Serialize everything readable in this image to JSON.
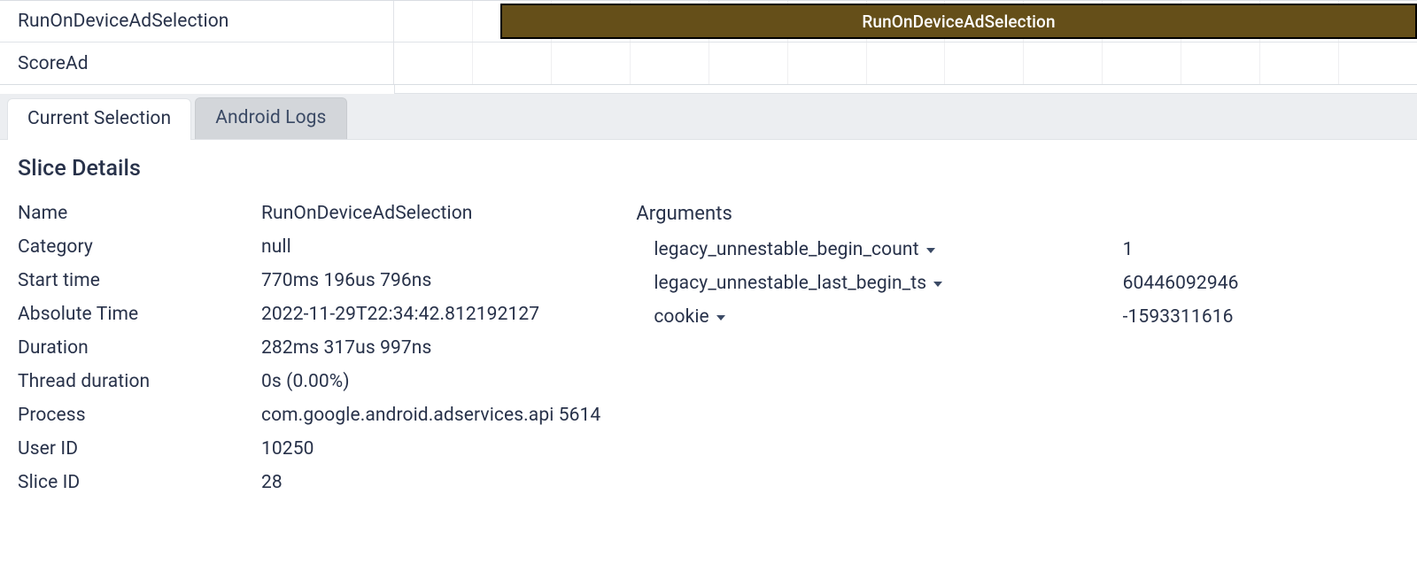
{
  "tracks": {
    "row1_label": "RunOnDeviceAdSelection",
    "row1_slice_title": "RunOnDeviceAdSelection",
    "row2_label": "ScoreAd"
  },
  "tabs": {
    "current": "Current Selection",
    "logs": "Android Logs"
  },
  "details": {
    "heading": "Slice Details",
    "labels": {
      "name": "Name",
      "category": "Category",
      "start_time": "Start time",
      "absolute_time": "Absolute Time",
      "duration": "Duration",
      "thread_duration": "Thread duration",
      "process": "Process",
      "user_id": "User ID",
      "slice_id": "Slice ID"
    },
    "values": {
      "name": "RunOnDeviceAdSelection",
      "category": "null",
      "start_time": "770ms 196us 796ns",
      "absolute_time": "2022-11-29T22:34:42.812192127",
      "duration": "282ms 317us 997ns",
      "thread_duration": "0s (0.00%)",
      "process": "com.google.android.adservices.api 5614",
      "user_id": "10250",
      "slice_id": "28"
    }
  },
  "arguments": {
    "heading": "Arguments",
    "items": {
      "k1": "legacy_unnestable_begin_count",
      "v1": "1",
      "k2": "legacy_unnestable_last_begin_ts",
      "v2": "60446092946",
      "k3": "cookie",
      "v3": "-1593311616"
    }
  }
}
